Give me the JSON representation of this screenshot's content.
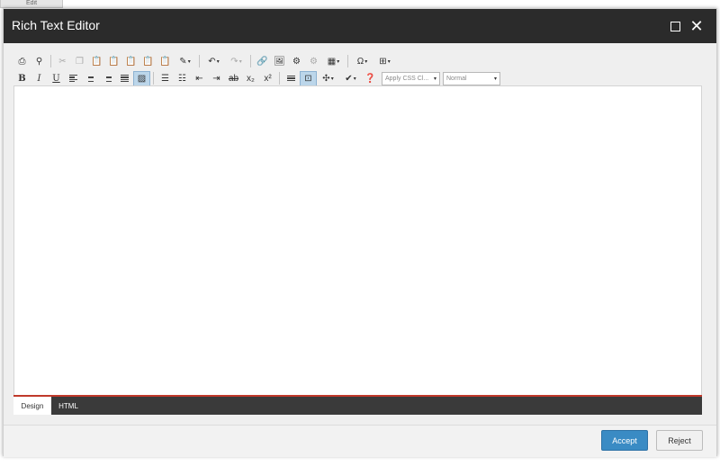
{
  "background": {
    "tab_label": "Edit"
  },
  "dialog": {
    "title": "Rich Text Editor"
  },
  "toolbar": {
    "css_class_select": "Apply CSS Cl...",
    "format_select": "Normal"
  },
  "modes": {
    "design": "Design",
    "html": "HTML"
  },
  "footer": {
    "accept": "Accept",
    "reject": "Reject"
  },
  "colors": {
    "titlebar": "#2b2b2b",
    "accent": "#3a8bc4",
    "mode_border": "#c0392b",
    "active_tool": "#bcd6ea"
  },
  "icons": [
    "print-icon",
    "find-icon",
    "cut-icon",
    "copy-icon",
    "paste-icon",
    "paste-text-icon",
    "paste-word-icon",
    "paste-html-icon",
    "format-stripper-icon",
    "undo-icon",
    "redo-icon",
    "link-icon",
    "image-icon",
    "media-icon",
    "document-icon",
    "table-icon",
    "symbol-icon",
    "snippet-icon",
    "bold-icon",
    "italic-icon",
    "underline-icon",
    "align-left-icon",
    "align-center-icon",
    "align-right-icon",
    "align-justify-icon",
    "ordered-list-icon",
    "bullet-list-icon",
    "outdent-icon",
    "indent-icon",
    "strike-icon",
    "subscript-icon",
    "superscript-icon",
    "help-icon"
  ]
}
